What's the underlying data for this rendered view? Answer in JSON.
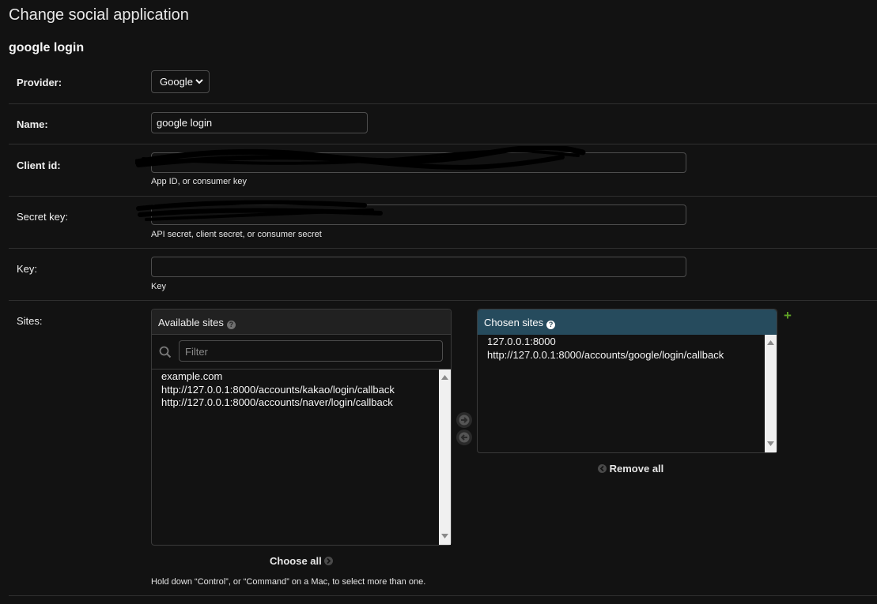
{
  "page": {
    "title": "Change social application",
    "object_title": "google login"
  },
  "form": {
    "provider": {
      "label": "Provider:",
      "value": "Google"
    },
    "name": {
      "label": "Name:",
      "value": "google login"
    },
    "client_id": {
      "label": "Client id:",
      "help": "App ID, or consumer key"
    },
    "secret_key": {
      "label": "Secret key:",
      "help": "API secret, client secret, or consumer secret"
    },
    "key": {
      "label": "Key:",
      "value": "",
      "help": "Key"
    },
    "sites": {
      "label": "Sites:",
      "available_title": "Available sites",
      "filter_placeholder": "Filter",
      "available_options": [
        "example.com",
        "http://127.0.0.1:8000/accounts/kakao/login/callback",
        "http://127.0.0.1:8000/accounts/naver/login/callback"
      ],
      "chosen_title": "Chosen sites",
      "chosen_options": [
        "127.0.0.1:8000",
        "http://127.0.0.1:8000/accounts/google/login/callback"
      ],
      "choose_all": "Choose all",
      "remove_all": "Remove all",
      "add_icon": "+",
      "help": "Hold down “Control”, or “Command” on a Mac, to select more than one."
    }
  },
  "colors": {
    "background": "#121212",
    "chosen_header": "#264b5d",
    "add_green": "#5fa225"
  },
  "icons": [
    "chevron-down-icon",
    "help-icon",
    "search-icon",
    "arrow-right-icon",
    "arrow-left-icon",
    "plus-icon",
    "scroll-up-icon",
    "scroll-down-icon"
  ]
}
